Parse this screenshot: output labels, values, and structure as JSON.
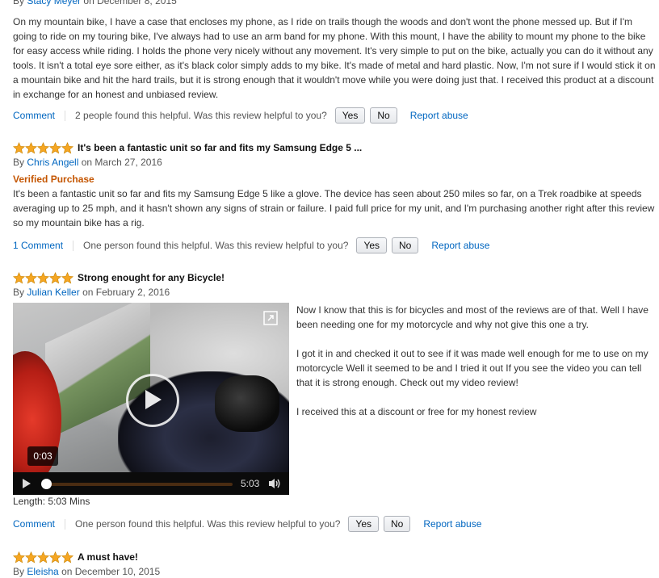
{
  "reviews": [
    {
      "author": "Stacy Meyer",
      "date": "on December 8, 2015",
      "by": "By",
      "body": "On my mountain bike, I have a case that encloses my phone, as I ride on trails though the woods and don't wont the phone messed up. But if I'm going to ride on my touring bike, I've always had to use an arm band for my phone. With this mount, I have the ability to mount my phone to the bike for easy access while riding. I holds the phone very nicely without any movement. It's very simple to put on the bike, actually you can do it without any tools. It isn't a total eye sore either, as it's black color simply adds to my bike. It's made of metal and hard plastic. Now, I'm not sure if I would stick it on a mountain bike and hit the hard trails, but it is strong enough that it wouldn't move while you were doing just that. I received this product at a discount in exchange for an honest and unbiased review.",
      "comment_label": "Comment",
      "helpful_text": "2 people found this helpful. Was this review helpful to you?",
      "yes": "Yes",
      "no": "No",
      "report": "Report abuse"
    },
    {
      "rating": 5,
      "title": "It's been a fantastic unit so far and fits my Samsung Edge 5 ...",
      "by": "By",
      "author": "Chris Angell",
      "date": "on March 27, 2016",
      "verified": "Verified Purchase",
      "body": "It's been a fantastic unit so far and fits my Samsung Edge 5 like a glove. The device has seen about 250 miles so far, on a Trek roadbike at speeds averaging up to 25 mph, and it hasn't shown any signs of strain or failure. I paid full price for my unit, and I'm purchasing another right after this review so my mountain bike has a rig.",
      "comment_label": "1 Comment",
      "helpful_text": "One person found this helpful. Was this review helpful to you?",
      "yes": "Yes",
      "no": "No",
      "report": "Report abuse"
    },
    {
      "rating": 5,
      "title": "Strong enought for any Bicycle!",
      "by": "By",
      "author": "Julian Keller",
      "date": "on February 2, 2016",
      "video": {
        "current_time_bubble": "0:03",
        "duration": "5:03",
        "progress": 0.01
      },
      "length": "Length: 5:03 Mins",
      "paragraphs": [
        "Now I know that this is for bicycles and most of the reviews are of that. Well I have been needing one for my motorcycle and why not give this one a try.",
        "I got it in and checked it out to see if it was made well enough for me to use on my motorcycle Well it seemed to be and I tried it out If you see the video you can tell that it is strong enough. Check out my video review!",
        "I received this at a discount or free for my honest review"
      ],
      "comment_label": "Comment",
      "helpful_text": "One person found this helpful. Was this review helpful to you?",
      "yes": "Yes",
      "no": "No",
      "report": "Report abuse"
    },
    {
      "rating": 5,
      "title": "A must have!",
      "by": "By",
      "author": "Eleisha",
      "date": "on December 10, 2015"
    }
  ],
  "colors": {
    "star": "#f5a623",
    "link": "#0066c0",
    "verified": "#c45500"
  }
}
